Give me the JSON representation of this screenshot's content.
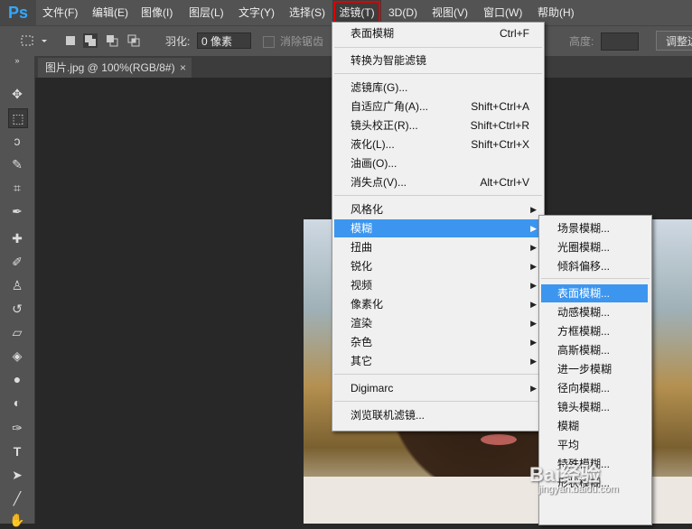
{
  "app": {
    "logo": "Ps"
  },
  "menubar": {
    "items": [
      "文件(F)",
      "编辑(E)",
      "图像(I)",
      "图层(L)",
      "文字(Y)",
      "选择(S)",
      "滤镜(T)",
      "3D(D)",
      "视图(V)",
      "窗口(W)",
      "帮助(H)"
    ],
    "active_index": 6
  },
  "options": {
    "feather_label": "羽化:",
    "feather_value": "0 像素",
    "antialias_label": "消除锯齿",
    "height_label": "高度:",
    "refine_label": "调整边"
  },
  "document": {
    "tab_title": "图片.jpg @ 100%(RGB/8#)",
    "close_glyph": "×"
  },
  "filter_menu": {
    "items": [
      {
        "label": "表面模糊",
        "shortcut": "Ctrl+F"
      },
      {
        "label": "转换为智能滤镜",
        "shortcut": ""
      },
      {
        "label": "滤镜库(G)...",
        "shortcut": ""
      },
      {
        "label": "自适应广角(A)...",
        "shortcut": "Shift+Ctrl+A"
      },
      {
        "label": "镜头校正(R)...",
        "shortcut": "Shift+Ctrl+R"
      },
      {
        "label": "液化(L)...",
        "shortcut": "Shift+Ctrl+X"
      },
      {
        "label": "油画(O)...",
        "shortcut": ""
      },
      {
        "label": "消失点(V)...",
        "shortcut": "Alt+Ctrl+V"
      },
      {
        "label": "风格化",
        "shortcut": ""
      },
      {
        "label": "模糊",
        "shortcut": ""
      },
      {
        "label": "扭曲",
        "shortcut": ""
      },
      {
        "label": "锐化",
        "shortcut": ""
      },
      {
        "label": "视频",
        "shortcut": ""
      },
      {
        "label": "像素化",
        "shortcut": ""
      },
      {
        "label": "渲染",
        "shortcut": ""
      },
      {
        "label": "杂色",
        "shortcut": ""
      },
      {
        "label": "其它",
        "shortcut": ""
      },
      {
        "label": "Digimarc",
        "shortcut": ""
      },
      {
        "label": "浏览联机滤镜...",
        "shortcut": ""
      }
    ]
  },
  "blur_submenu": {
    "items": [
      "场景模糊...",
      "光圈模糊...",
      "倾斜偏移...",
      "表面模糊...",
      "动感模糊...",
      "方框模糊...",
      "高斯模糊...",
      "进一步模糊",
      "径向模糊...",
      "镜头模糊...",
      "模糊",
      "平均",
      "特殊模糊...",
      "形状模糊..."
    ]
  },
  "watermark": {
    "text": "Bai经验",
    "sub": "jingyan.baidu.com"
  }
}
